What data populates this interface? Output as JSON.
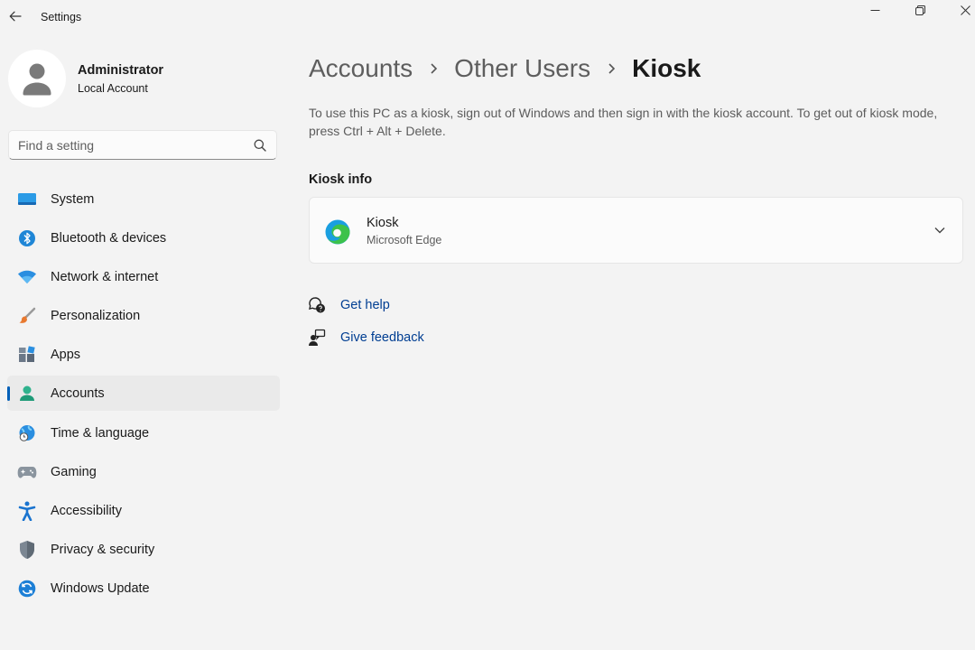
{
  "window": {
    "title": "Settings",
    "icons": {
      "back": "back-arrow-icon",
      "minimize": "minimize-icon",
      "maximize": "restore-icon",
      "close": "close-icon"
    }
  },
  "user": {
    "name": "Administrator",
    "account_type": "Local Account",
    "icon": "avatar-icon"
  },
  "search": {
    "placeholder": "Find a setting",
    "value": "",
    "icon": "search-icon"
  },
  "sidebar": {
    "items": [
      {
        "label": "System",
        "icon": "system-icon"
      },
      {
        "label": "Bluetooth & devices",
        "icon": "bluetooth-icon"
      },
      {
        "label": "Network & internet",
        "icon": "wifi-icon"
      },
      {
        "label": "Personalization",
        "icon": "brush-icon"
      },
      {
        "label": "Apps",
        "icon": "apps-icon"
      },
      {
        "label": "Accounts",
        "icon": "accounts-icon",
        "selected": true
      },
      {
        "label": "Time & language",
        "icon": "globe-clock-icon"
      },
      {
        "label": "Gaming",
        "icon": "gamepad-icon"
      },
      {
        "label": "Accessibility",
        "icon": "accessibility-icon"
      },
      {
        "label": "Privacy & security",
        "icon": "shield-icon"
      },
      {
        "label": "Windows Update",
        "icon": "update-icon"
      }
    ]
  },
  "breadcrumb": {
    "items": [
      "Accounts",
      "Other Users",
      "Kiosk"
    ],
    "separator_icon": "chevron-right-icon"
  },
  "description": "To use this PC as a kiosk, sign out of Windows and then sign in with the kiosk account. To get out of kiosk mode, press Ctrl + Alt + Delete.",
  "kiosk_info": {
    "heading": "Kiosk info",
    "card": {
      "title": "Kiosk",
      "subtitle": "Microsoft Edge",
      "icon": "edge-icon",
      "expand_icon": "chevron-down-icon"
    }
  },
  "links": {
    "help": {
      "label": "Get help",
      "icon": "help-icon"
    },
    "feedback": {
      "label": "Give feedback",
      "icon": "feedback-icon"
    }
  },
  "colors": {
    "accent": "#005fb8",
    "link": "#003e92",
    "background": "#f3f3f3",
    "card": "#fbfbfb"
  }
}
